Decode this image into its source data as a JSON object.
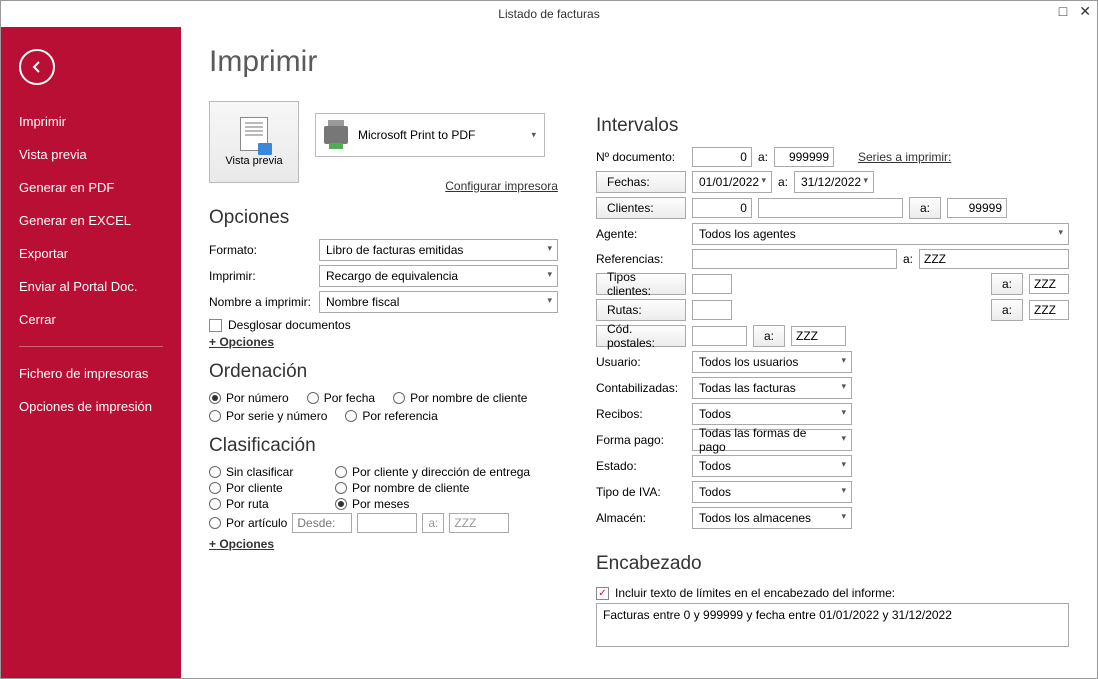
{
  "window": {
    "title": "Listado de facturas"
  },
  "sidebar": {
    "items": [
      "Imprimir",
      "Vista previa",
      "Generar en PDF",
      "Generar en EXCEL",
      "Exportar",
      "Enviar al Portal Doc.",
      "Cerrar"
    ],
    "items2": [
      "Fichero de impresoras",
      "Opciones de impresión"
    ]
  },
  "page": {
    "title": "Imprimir",
    "previewLabel": "Vista previa",
    "printerName": "Microsoft Print to PDF",
    "configurePrinter": "Configurar impresora"
  },
  "opciones": {
    "title": "Opciones",
    "formatoLabel": "Formato:",
    "formatoValue": "Libro de facturas emitidas",
    "imprimirLabel": "Imprimir:",
    "imprimirValue": "Recargo de equivalencia",
    "nombreLabel": "Nombre a imprimir:",
    "nombreValue": "Nombre fiscal",
    "desglosar": "Desglosar documentos",
    "masOpciones": "+ Opciones"
  },
  "ordenacion": {
    "title": "Ordenación",
    "opts": [
      "Por número",
      "Por fecha",
      "Por nombre de cliente",
      "Por serie y número",
      "Por referencia"
    ],
    "selected": "Por número"
  },
  "clasificacion": {
    "title": "Clasificación",
    "colA": [
      "Sin clasificar",
      "Por cliente",
      "Por ruta",
      "Por artículo"
    ],
    "colB": [
      "Por cliente y dirección de entrega",
      "Por nombre de cliente",
      "Por meses"
    ],
    "selected": "Por meses",
    "desdeLabel": "Desde:",
    "aLabel": "a:",
    "aValue": "ZZZ",
    "masOpciones": "+ Opciones"
  },
  "intervalos": {
    "title": "Intervalos",
    "docLabel": "Nº documento:",
    "docFrom": "0",
    "docTo": "999999",
    "seriesLink": "Series a imprimir:",
    "fechasBtn": "Fechas:",
    "fechaFrom": "01/01/2022",
    "fechaTo": "31/12/2022",
    "clientesBtn": "Clientes:",
    "clienteFrom": "0",
    "clienteTo": "99999",
    "agenteLabel": "Agente:",
    "agenteValue": "Todos los agentes",
    "refLabel": "Referencias:",
    "refTo": "ZZZ",
    "tiposBtn": "Tipos clientes:",
    "tiposTo": "ZZZ",
    "rutasBtn": "Rutas:",
    "rutasTo": "ZZZ",
    "cpBtn": "Cód. postales:",
    "cpTo": "ZZZ",
    "usuarioLabel": "Usuario:",
    "usuarioValue": "Todos los usuarios",
    "contabLabel": "Contabilizadas:",
    "contabValue": "Todas las facturas",
    "recibosLabel": "Recibos:",
    "recibosValue": "Todos",
    "formaLabel": "Forma pago:",
    "formaValue": "Todas las formas de pago",
    "estadoLabel": "Estado:",
    "estadoValue": "Todos",
    "ivaLabel": "Tipo de IVA:",
    "ivaValue": "Todos",
    "almacenLabel": "Almacén:",
    "almacenValue": "Todos los almacenes",
    "aShort": "a:"
  },
  "encabezado": {
    "title": "Encabezado",
    "chkLabel": "Incluir texto de límites en el encabezado del informe:",
    "text": "Facturas entre 0 y 999999 y fecha entre 01/01/2022 y 31/12/2022"
  }
}
